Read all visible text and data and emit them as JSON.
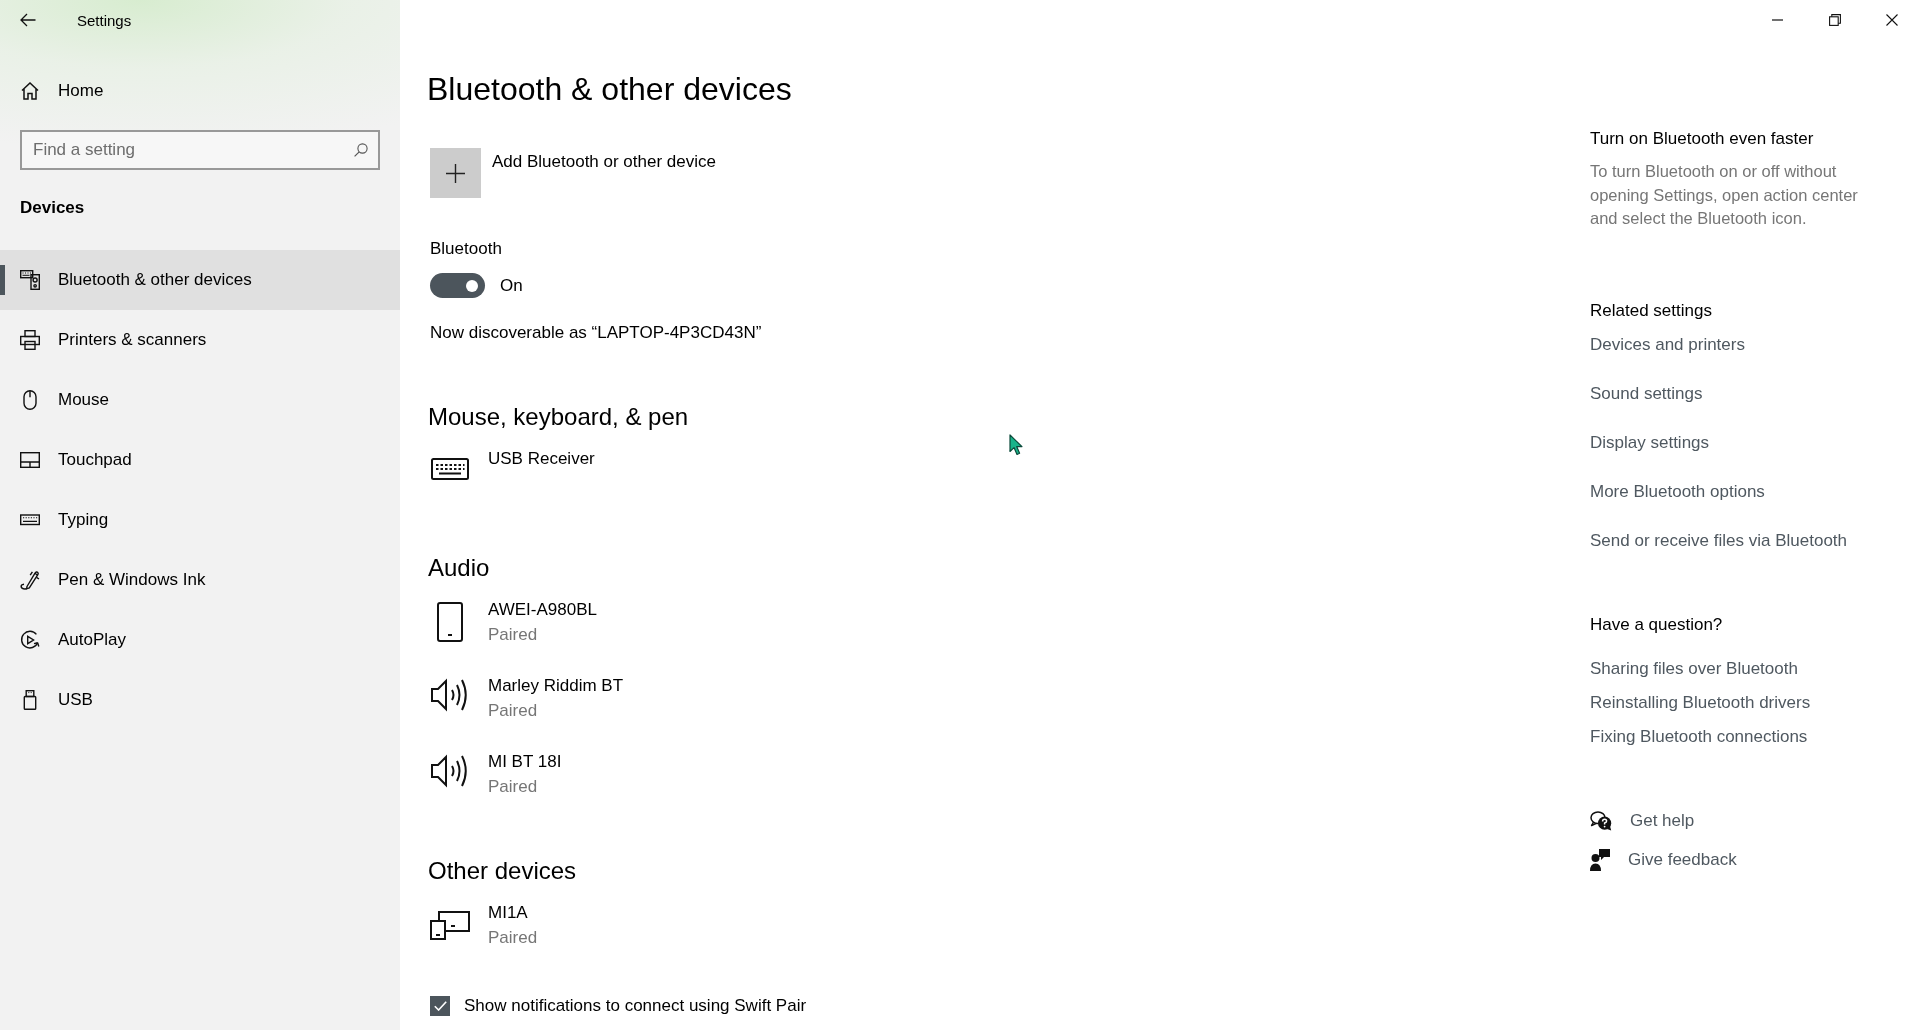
{
  "window": {
    "title": "Settings"
  },
  "sidebar": {
    "home": "Home",
    "search": {
      "placeholder": "Find a setting"
    },
    "section": "Devices",
    "items": [
      {
        "label": "Bluetooth & other devices",
        "kind": "bluetooth",
        "selected": true
      },
      {
        "label": "Printers & scanners",
        "kind": "printer",
        "selected": false
      },
      {
        "label": "Mouse",
        "kind": "mouse",
        "selected": false
      },
      {
        "label": "Touchpad",
        "kind": "touchpad",
        "selected": false
      },
      {
        "label": "Typing",
        "kind": "typing",
        "selected": false
      },
      {
        "label": "Pen & Windows Ink",
        "kind": "pen",
        "selected": false
      },
      {
        "label": "AutoPlay",
        "kind": "autoplay",
        "selected": false
      },
      {
        "label": "USB",
        "kind": "usb",
        "selected": false
      }
    ]
  },
  "page": {
    "title": "Bluetooth & other devices",
    "add_device": "Add Bluetooth or other device",
    "bluetooth": {
      "label": "Bluetooth",
      "on": true,
      "state": "On",
      "discoverable": "Now discoverable as “LAPTOP-4P3CD43N”"
    },
    "sections": [
      {
        "heading": "Mouse, keyboard, & pen",
        "devices": [
          {
            "name": "USB Receiver",
            "kind": "keyboard"
          }
        ]
      },
      {
        "heading": "Audio",
        "devices": [
          {
            "name": "AWEI-A980BL",
            "status": "Paired",
            "kind": "phone"
          },
          {
            "name": "Marley Riddim BT",
            "status": "Paired",
            "kind": "speaker"
          },
          {
            "name": "MI BT 18I",
            "status": "Paired",
            "kind": "speaker"
          }
        ]
      },
      {
        "heading": "Other devices",
        "devices": [
          {
            "name": "MI1A",
            "status": "Paired",
            "kind": "devices"
          }
        ]
      }
    ],
    "swift_pair": {
      "label": "Show notifications to connect using Swift Pair",
      "checked": true
    }
  },
  "side_panel": {
    "tip": {
      "title": "Turn on Bluetooth even faster",
      "text": "To turn Bluetooth on or off without opening Settings, open action center and select the Bluetooth icon."
    },
    "related": {
      "heading": "Related settings",
      "links": [
        "Devices and printers",
        "Sound settings",
        "Display settings",
        "More Bluetooth options",
        "Send or receive files via Bluetooth"
      ]
    },
    "help": {
      "heading": "Have a question?",
      "links": [
        "Sharing files over Bluetooth",
        "Reinstalling Bluetooth drivers",
        "Fixing Bluetooth connections"
      ]
    },
    "actions": [
      {
        "label": "Get help",
        "kind": "help"
      },
      {
        "label": "Give feedback",
        "kind": "feedback"
      }
    ]
  }
}
